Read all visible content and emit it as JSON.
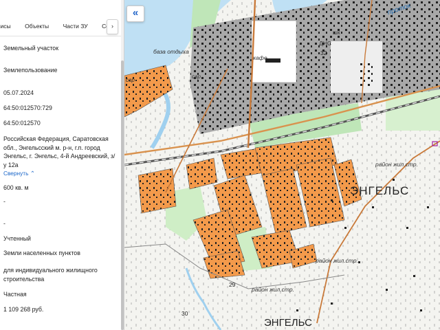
{
  "tabs": [
    "висы",
    "Объекты",
    "Части ЗУ",
    "Соста"
  ],
  "tabs_next": "›",
  "collapse_label": "«",
  "fields": [
    {
      "text": "Земельный участок"
    },
    {
      "text": "Землепользование"
    },
    {
      "text": "05.07.2024"
    },
    {
      "text": "64:50:012570:729"
    },
    {
      "text": "64:50:012570"
    },
    {
      "text": "Российская Федерация, Саратовская обл., Энгельсский м. р-н, г.п. город Энгельс, г. Энгельс, 4-й Андреевский, з/у 12а"
    },
    {
      "text": "600 кв. м"
    },
    {
      "text": "-"
    },
    {
      "text": "-"
    },
    {
      "text": "Учтенный"
    },
    {
      "text": "Земли населенных пунктов"
    },
    {
      "text": "для индивидуального жилищного строительства"
    },
    {
      "text": "Частная"
    },
    {
      "text": "1 109 268 руб."
    }
  ],
  "collapse_link": "Свернуть",
  "collapse_chevron": "⌃",
  "map_labels": {
    "city": "ЭНГЕЛЬС",
    "city_bottom": "ЭНГЕЛЬС",
    "district1": "район жил.стр.",
    "district2": "район жил.стр.",
    "district3": "район жил.стр.",
    "base": "база отдыха",
    "cafe": "кафе",
    "school": "шк",
    "dns": "ДНС",
    "sar": "сар",
    "sar2": "сар",
    "n32": "32",
    "n29": "29",
    "n30": "30",
    "protoka": "проток"
  }
}
